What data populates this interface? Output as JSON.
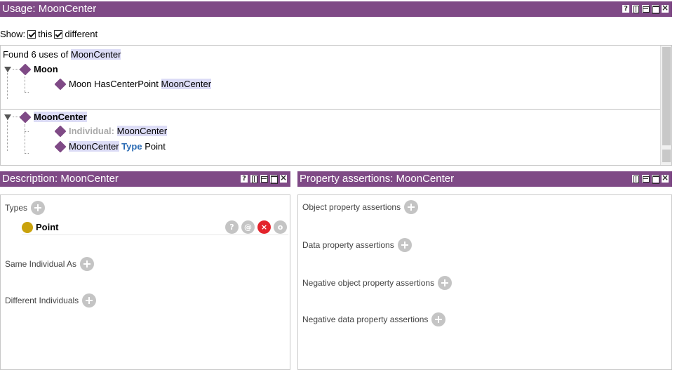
{
  "usage": {
    "title": "Usage: MoonCenter",
    "show_label": "Show:",
    "this_label": "this",
    "different_label": "different",
    "found_prefix": "Found 6 uses of",
    "found_entity": "MoonCenter",
    "groups": [
      {
        "name": "Moon",
        "items": [
          {
            "pre": "Moon HasCenterPoint",
            "entity": "MoonCenter"
          }
        ]
      },
      {
        "name": "MoonCenter",
        "items": [
          {
            "kw": "Individual:",
            "entity": "MoonCenter"
          },
          {
            "pre": "MoonCenter",
            "kw": "Type",
            "post": "Point"
          }
        ]
      }
    ]
  },
  "description": {
    "title": "Description: MoonCenter",
    "types_label": "Types",
    "type_value": "Point",
    "same_label": "Same Individual As",
    "different_label": "Different Individuals",
    "actions": {
      "help": "?",
      "annotate": "@",
      "delete": "×",
      "edit": "o"
    }
  },
  "property_assertions": {
    "title": "Property assertions: MoonCenter",
    "sections": [
      "Object property assertions",
      "Data property assertions",
      "Negative object property assertions",
      "Negative data property assertions"
    ]
  },
  "window_controls": {
    "help": "?"
  },
  "colors": {
    "header": "#7f4a86",
    "highlight": "#dcdcf6",
    "class_dot": "#c9a20c",
    "delete": "#e3232b",
    "keyword": "#2a6bb4"
  }
}
